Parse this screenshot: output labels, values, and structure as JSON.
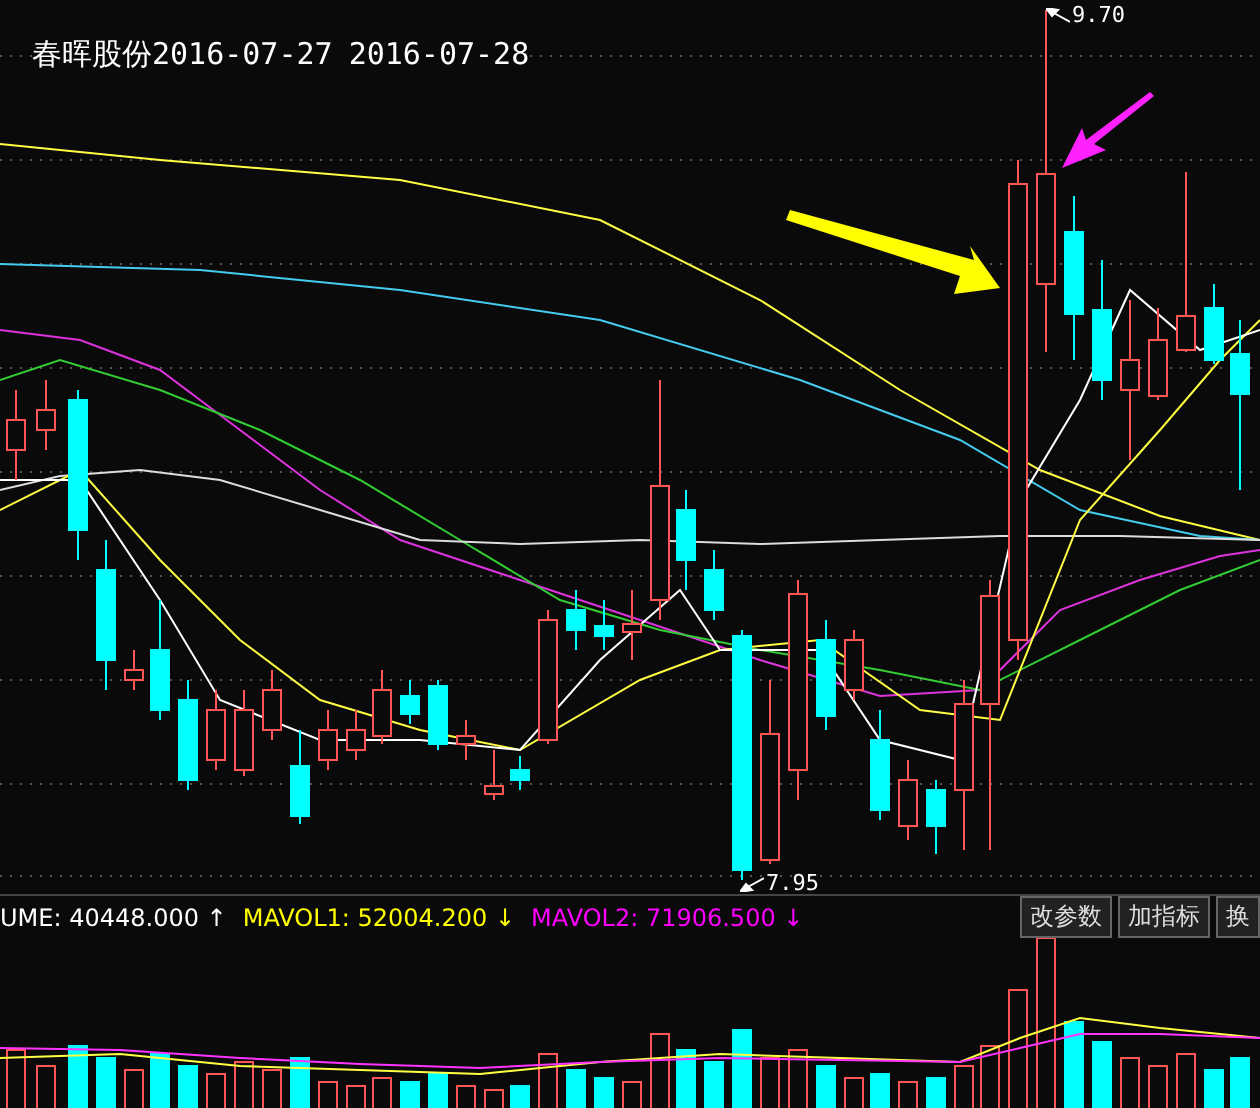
{
  "title": {
    "name": "春晖股份",
    "dates": [
      "2016-07-27",
      "2016-07-28"
    ]
  },
  "chart": {
    "high_label": "9.70",
    "low_label": "7.95"
  },
  "indicator_bar": {
    "items": [
      {
        "label": "UME: 40448.000",
        "arrow": "↑",
        "color": "#ffffff"
      },
      {
        "label": "MAVOL1: 52004.200",
        "arrow": "↓",
        "color": "#ffff00"
      },
      {
        "label": "MAVOL2: 71906.500",
        "arrow": "↓",
        "color": "#ff00ff"
      }
    ]
  },
  "buttons": [
    "改参数",
    "加指标",
    "换"
  ]
}
